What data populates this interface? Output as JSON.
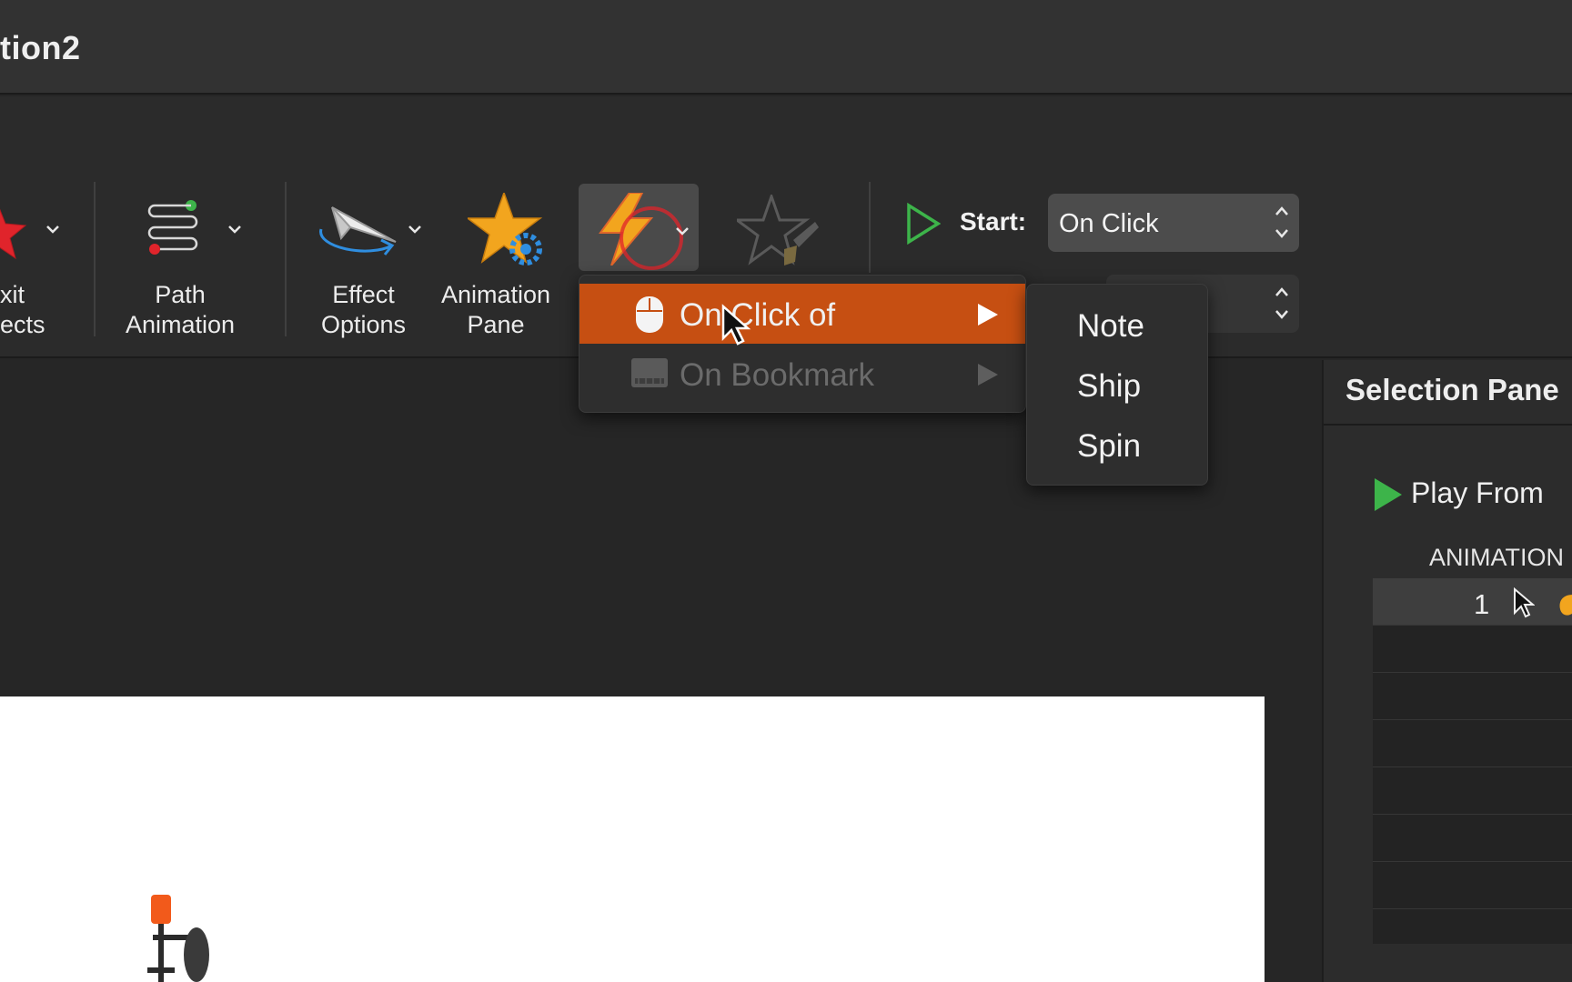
{
  "window": {
    "title": "tion2"
  },
  "ribbon": {
    "exit_effects_label": "xit\nects",
    "path_animation_label": "Path\nAnimation",
    "effect_options_label": "Effect\nOptions",
    "animation_pane_label": "Animation\nPane",
    "start_label": "Start:",
    "start_value": "On Click"
  },
  "trigger_menu": {
    "items": [
      {
        "label": "On Click of",
        "highlighted": true,
        "enabled": true
      },
      {
        "label": "On Bookmark",
        "highlighted": false,
        "enabled": false
      }
    ],
    "submenu": [
      "Note",
      "Ship",
      "Spin"
    ]
  },
  "selection_pane": {
    "title": "Selection Pane",
    "play_from": "Play From",
    "list_header": "ANIMATION",
    "rows": [
      {
        "number": "1"
      }
    ]
  },
  "colors": {
    "highlight": "#c64f12",
    "play_green": "#3db44a",
    "accent_blue": "#2f8ee0"
  }
}
